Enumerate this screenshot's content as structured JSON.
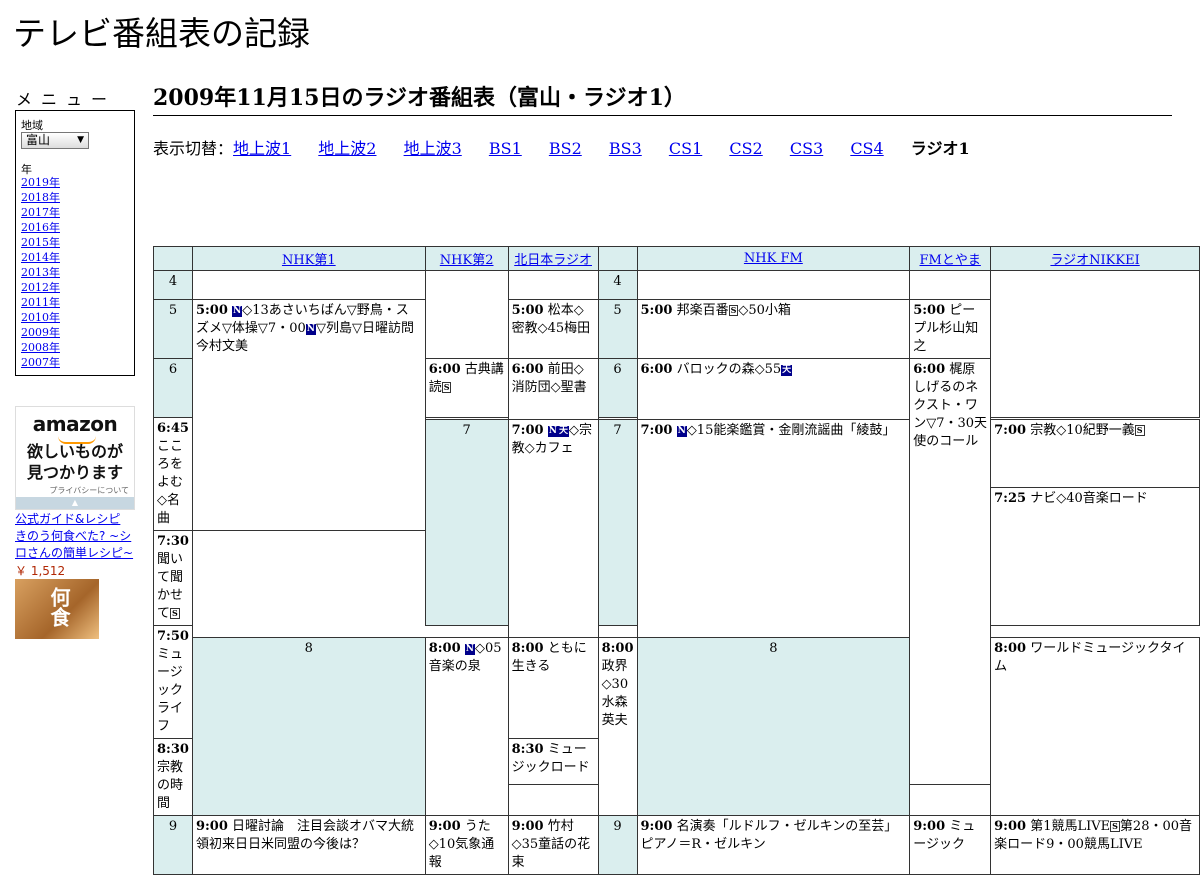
{
  "site": {
    "title": "テレビ番組表の記録"
  },
  "menu": {
    "label": "メニュー",
    "region_label": "地域",
    "region_value": "富山",
    "year_label": "年",
    "years": [
      "2019年",
      "2018年",
      "2017年",
      "2016年",
      "2015年",
      "2014年",
      "2013年",
      "2012年",
      "2011年",
      "2010年",
      "2009年",
      "2008年",
      "2007年"
    ]
  },
  "ad": {
    "logo": "amazon",
    "tagline_1": "欲しいものが",
    "tagline_2": "見つかります",
    "privacy": "プライバシーについて",
    "product_title": "公式ガイド&レシピ きのう何食べた? ~シロさんの簡単レシピ~",
    "product_price": "￥ 1,512",
    "product_image_text": "何食"
  },
  "page": {
    "title": "2009年11月15日のラジオ番組表（富山・ラジオ1）",
    "switch_label": "表示切替：",
    "switch_links": [
      "地上波1",
      "地上波2",
      "地上波3",
      "BS1",
      "BS2",
      "BS3",
      "CS1",
      "CS2",
      "CS3",
      "CS4"
    ],
    "switch_current": "ラジオ1"
  },
  "markers": {
    "news": "N",
    "stereo": "S",
    "weather": "天"
  },
  "schedule": {
    "channels": [
      "NHK第1",
      "NHK第2",
      "北日本ラジオ",
      "NHK FM",
      "FMとやま",
      "ラジオNIKKEI"
    ],
    "hours": [
      "4",
      "5",
      "6",
      "7",
      "8",
      "9"
    ],
    "programs": {
      "nhk1_0500": {
        "time": "5:00",
        "text_a": "◇13あさいちばん▽野鳥・スズメ▽体操▽7・00",
        "text_b": "▽列島▽日曜訪問　今村文美"
      },
      "nhk1_0800": {
        "time": "8:00",
        "text": "◇05音楽の泉"
      },
      "nhk1_0900": {
        "time": "9:00",
        "text": "日曜討論　注目会談オバマ大統領初来日日米同盟の今後は？"
      },
      "nhk2_0600": {
        "time": "6:00",
        "text": "古典講読"
      },
      "nhk2_0645": {
        "time": "6:45",
        "text": "こころをよむ◇名曲"
      },
      "nhk2_0730": {
        "time": "7:30",
        "text": "聞いて聞かせて"
      },
      "nhk2_0800": {
        "time": "8:00",
        "text": "ともに生きる"
      },
      "nhk2_0830": {
        "time": "8:30",
        "text": "宗教の時間"
      },
      "nhk2_0900": {
        "time": "9:00",
        "text": "うた◇10気象通報"
      },
      "knb_0500": {
        "time": "5:00",
        "text": "松本◇密教◇45梅田"
      },
      "knb_0600": {
        "time": "6:00",
        "text": "前田◇消防団◇聖書"
      },
      "knb_0700": {
        "time": "7:00",
        "text": "◇宗教◇カフェ"
      },
      "knb_0800": {
        "time": "8:00",
        "text": "政界◇30水森英夫"
      },
      "knb_0900": {
        "time": "9:00",
        "text": "竹村◇35童話の花束"
      },
      "fm_0500": {
        "time": "5:00",
        "text": "邦楽百番",
        "text_b": "◇50小箱"
      },
      "fm_0600": {
        "time": "6:00",
        "text": "バロックの森◇55"
      },
      "fm_0700": {
        "time": "7:00",
        "text": "◇15能楽鑑賞・金剛流謡曲「綾鼓」"
      },
      "fm_0800": {
        "time": "8:00",
        "text": "ワールドミュージックタイム"
      },
      "fm_0900": {
        "time": "9:00",
        "text": "名演奏「ルドルフ・ゼルキンの至芸」ピアノ＝R・ゼルキン"
      },
      "fmt_0500": {
        "time": "5:00",
        "text": "ピープル杉山知之"
      },
      "fmt_0600": {
        "time": "6:00",
        "text": "梶原しげるのネクスト・ワン▽7・30天使のコール"
      },
      "fmt_0900": {
        "time": "9:00",
        "text": "ミュージック"
      },
      "nikkei_0700": {
        "time": "7:00",
        "text": "宗教◇10紀野一義"
      },
      "nikkei_0725": {
        "time": "7:25",
        "text": "ナビ◇40音楽ロード"
      },
      "nikkei_0750": {
        "time": "7:50",
        "text": "ミュージックライフ"
      },
      "nikkei_0830": {
        "time": "8:30",
        "text": "ミュージックロード"
      },
      "nikkei_0900": {
        "time": "9:00",
        "text": "第1競馬LIVE",
        "text_b": "第28・00音楽ロード9・00競馬LIVE"
      }
    }
  }
}
